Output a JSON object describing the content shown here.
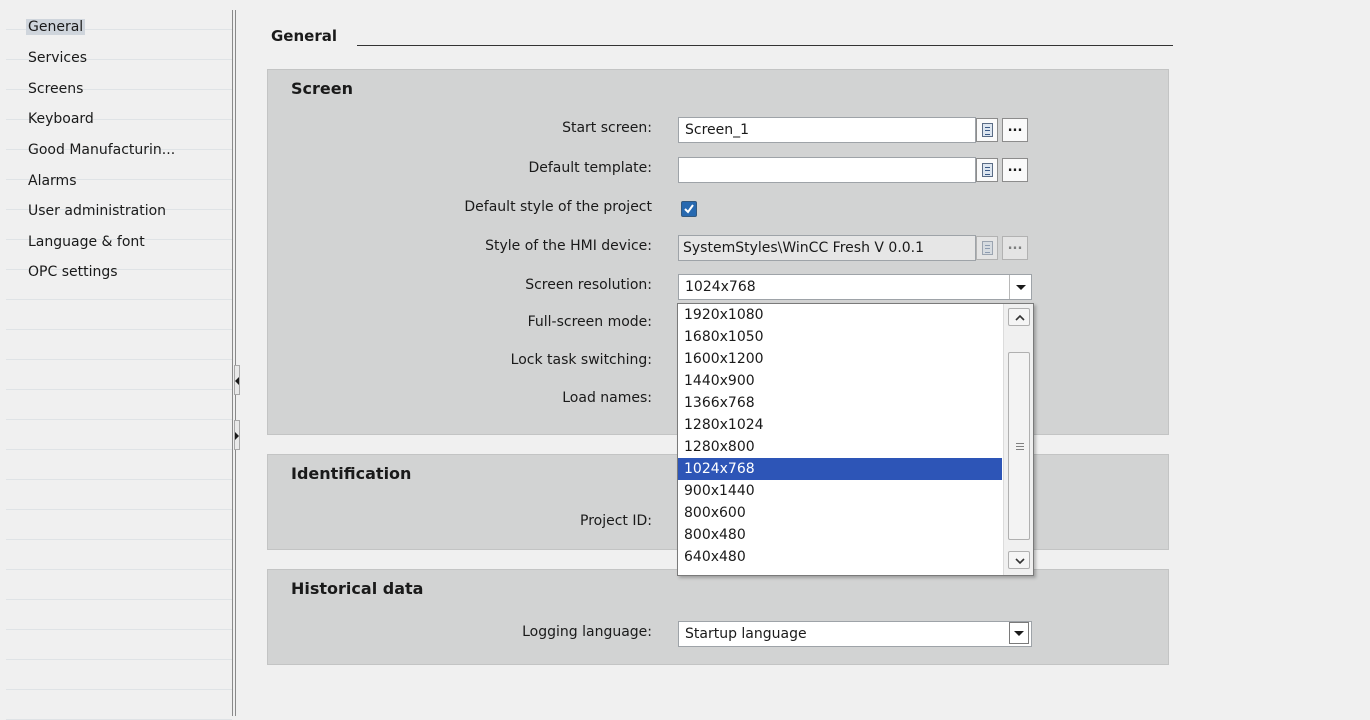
{
  "nav": {
    "items": [
      {
        "label": "General",
        "selected": true
      },
      {
        "label": "Services"
      },
      {
        "label": "Screens"
      },
      {
        "label": "Keyboard"
      },
      {
        "label": "Good Manufacturin..."
      },
      {
        "label": "Alarms"
      },
      {
        "label": "User administration"
      },
      {
        "label": "Language & font"
      },
      {
        "label": "OPC settings"
      }
    ]
  },
  "page": {
    "title": "General"
  },
  "screen_section": {
    "title": "Screen",
    "start_screen": {
      "label": "Start screen:",
      "value": "Screen_1"
    },
    "default_template": {
      "label": "Default template:",
      "value": ""
    },
    "default_style": {
      "label": "Default style of the project",
      "checked": true
    },
    "hmi_style": {
      "label": "Style of the HMI device:",
      "value": "SystemStyles\\WinCC Fresh V 0.0.1"
    },
    "screen_resolution": {
      "label": "Screen resolution:",
      "value": "1024x768",
      "options": [
        "1920x1080",
        "1680x1050",
        "1600x1200",
        "1440x900",
        "1366x768",
        "1280x1024",
        "1280x800",
        "1024x768",
        "900x1440",
        "800x600",
        "800x480",
        "640x480"
      ],
      "selected": "1024x768"
    },
    "full_screen": {
      "label": "Full-screen mode:"
    },
    "lock_task": {
      "label": "Lock task switching:"
    },
    "load_names": {
      "label": "Load names:"
    }
  },
  "identification_section": {
    "title": "Identification",
    "project_id": {
      "label": "Project ID:"
    }
  },
  "historical_section": {
    "title": "Historical data",
    "logging_language": {
      "label": "Logging language:",
      "value": "Startup language"
    }
  },
  "buttons": {
    "browse": "...",
    "list": ""
  },
  "colors": {
    "accent": "#2d55b7",
    "section_bg": "#d2d3d3",
    "nav_selected": "#cfd5dc"
  }
}
